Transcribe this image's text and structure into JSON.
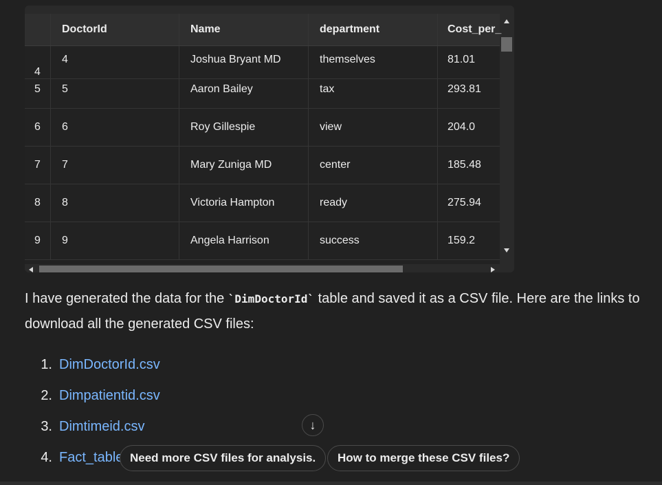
{
  "table": {
    "columns": [
      "",
      "DoctorId",
      "Name",
      "department",
      "Cost_per_"
    ],
    "partial_row": {
      "index": "4",
      "doctor_id": "4",
      "name": "Joshua Bryant MD",
      "department": "themselves",
      "cost": "81.01"
    },
    "rows": [
      {
        "index": "5",
        "doctor_id": "5",
        "name": "Aaron Bailey",
        "department": "tax",
        "cost": "293.81"
      },
      {
        "index": "6",
        "doctor_id": "6",
        "name": "Roy Gillespie",
        "department": "view",
        "cost": "204.0"
      },
      {
        "index": "7",
        "doctor_id": "7",
        "name": "Mary Zuniga MD",
        "department": "center",
        "cost": "185.48"
      },
      {
        "index": "8",
        "doctor_id": "8",
        "name": "Victoria Hampton",
        "department": "ready",
        "cost": "275.94"
      },
      {
        "index": "9",
        "doctor_id": "9",
        "name": "Angela Harrison",
        "department": "success",
        "cost": "159.2"
      }
    ]
  },
  "message": {
    "text_before": "I have generated the data for the ",
    "code": "`DimDoctorId`",
    "text_after": " table and saved it as a CSV file. Here are the links to download all the generated CSV files:"
  },
  "files": [
    {
      "num": "1.",
      "label": "DimDoctorId.csv"
    },
    {
      "num": "2.",
      "label": "Dimpatientid.csv"
    },
    {
      "num": "3.",
      "label": "Dimtimeid.csv"
    },
    {
      "num": "4.",
      "label": "Fact_table.c"
    }
  ],
  "scroll_down_icon": "arrow-down-icon",
  "suggestions": [
    "Need more CSV files for analysis.",
    "How to merge these CSV files?"
  ]
}
